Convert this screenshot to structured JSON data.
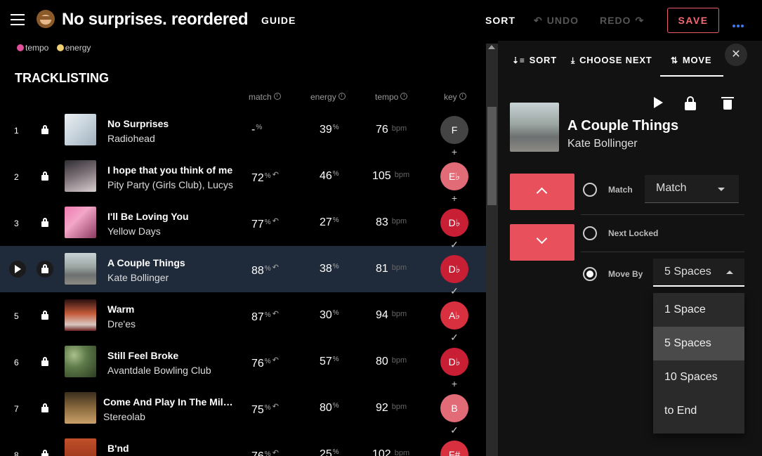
{
  "header": {
    "title": "No surprises. reordered",
    "guide_label": "GUIDE",
    "sort_label": "SORT",
    "undo_label": "UNDO",
    "redo_label": "REDO",
    "save_label": "SAVE"
  },
  "legend": {
    "tempo": "tempo",
    "energy": "energy",
    "tempo_color": "#e0509a",
    "energy_color": "#f0d070"
  },
  "tracklist": {
    "title": "TRACKLISTING",
    "columns": {
      "match": "match",
      "energy": "energy",
      "tempo": "tempo",
      "key": "key"
    },
    "pct": "%",
    "bpm": "bpm",
    "rows": [
      {
        "num": "1",
        "title": "No Surprises",
        "artist": "Radiohead",
        "match": "-",
        "energy": "39",
        "tempo": "76",
        "key": "F",
        "key_color": "#444444"
      },
      {
        "num": "2",
        "title": "I hope that you think of me",
        "artist": "Pity Party (Girls Club), Lucys",
        "match": "72",
        "energy": "46",
        "tempo": "105",
        "key": "E♭",
        "key_color": "#e26b78"
      },
      {
        "num": "3",
        "title": "I'll Be Loving You",
        "artist": "Yellow Days",
        "match": "77",
        "energy": "27",
        "tempo": "83",
        "key": "D♭",
        "key_color": "#c91f35"
      },
      {
        "num": "4",
        "title": "A Couple Things",
        "artist": "Kate Bollinger",
        "match": "88",
        "energy": "38",
        "tempo": "81",
        "key": "D♭",
        "key_color": "#c91f35"
      },
      {
        "num": "5",
        "title": "Warm",
        "artist": "Dre'es",
        "match": "87",
        "energy": "30",
        "tempo": "94",
        "key": "A♭",
        "key_color": "#d8303f"
      },
      {
        "num": "6",
        "title": "Still Feel Broke",
        "artist": "Avantdale Bowling Club",
        "match": "76",
        "energy": "57",
        "tempo": "80",
        "key": "D♭",
        "key_color": "#c91f35"
      },
      {
        "num": "7",
        "title": "Come And Play In The Milk…",
        "artist": "Stereolab",
        "match": "75",
        "energy": "80",
        "tempo": "92",
        "key": "B",
        "key_color": "#e26b78"
      },
      {
        "num": "8",
        "title": "B'nd",
        "artist": "",
        "match": "76",
        "energy": "25",
        "tempo": "102",
        "key": "F#",
        "key_color": "#d8303f"
      }
    ],
    "connectors": [
      "+",
      "+",
      "✓",
      "✓",
      "✓",
      "+",
      "✓"
    ]
  },
  "panel": {
    "tabs": {
      "sort": "SORT",
      "choose_next": "CHOOSE NEXT",
      "move": "MOVE"
    },
    "track_title": "A Couple Things",
    "track_artist": "Kate Bollinger",
    "options": {
      "match": "Match",
      "next_locked": "Next Locked",
      "move_by": "Move By"
    },
    "match_select": "Match",
    "move_by_select": "5 Spaces",
    "menu": [
      "1 Space",
      "5 Spaces",
      "10 Spaces",
      "to End"
    ]
  },
  "icons": [
    "menu-icon",
    "monkey-icon",
    "undo-icon",
    "redo-icon",
    "more-icon",
    "lock-icon",
    "play-icon",
    "info-icon",
    "close-icon",
    "trash-icon",
    "chevron-up-icon",
    "chevron-down-icon",
    "caret-icon"
  ]
}
